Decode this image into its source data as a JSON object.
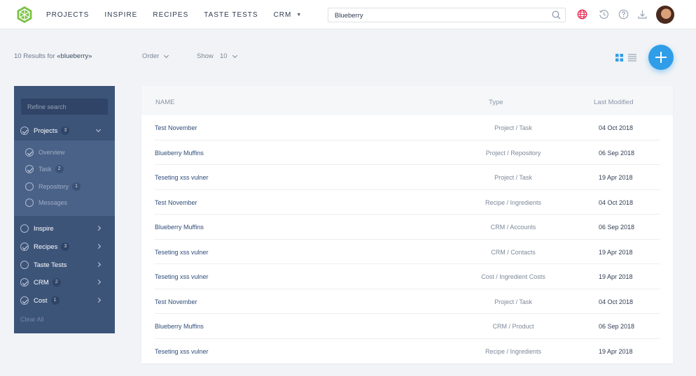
{
  "nav": {
    "items": [
      "PROJECTS",
      "INSPIRE",
      "RECIPES",
      "TASTE TESTS",
      "CRM"
    ]
  },
  "search": {
    "value": "Blueberry"
  },
  "results": {
    "prefix": "10 Results for",
    "query": "«blueberry»",
    "order_label": "Order",
    "show_label": "Show",
    "show_value": "10"
  },
  "sidebar": {
    "refine_placeholder": "Refine search",
    "projects": {
      "label": "Projects",
      "count": "3"
    },
    "sub_items": [
      {
        "label": "Overview",
        "count": ""
      },
      {
        "label": "Task",
        "count": "2"
      },
      {
        "label": "Repository",
        "count": "1"
      },
      {
        "label": "Messages",
        "count": ""
      }
    ],
    "categories": [
      {
        "label": "Inspire",
        "count": ""
      },
      {
        "label": "Recipes",
        "count": "3"
      },
      {
        "label": "Taste Tests",
        "count": ""
      },
      {
        "label": "CRM",
        "count": "2"
      },
      {
        "label": "Cost",
        "count": "1"
      }
    ],
    "clear_all": "Clear All"
  },
  "table": {
    "headers": {
      "name": "NAME",
      "type": "Type",
      "modified": "Last Modified"
    },
    "rows": [
      {
        "name": "Test November",
        "type": "Project / Task",
        "date": "04 Oct 2018"
      },
      {
        "name": "Blueberry Muffins",
        "type": "Project / Repository",
        "date": "06 Sep 2018"
      },
      {
        "name": "Teseting xss vulner",
        "type": "Project / Task",
        "date": "19 Apr 2018"
      },
      {
        "name": "Test November",
        "type": "Recipe / Ingredients",
        "date": "04 Oct 2018"
      },
      {
        "name": "Blueberry Muffins",
        "type": "CRM / Accounts",
        "date": "06 Sep 2018"
      },
      {
        "name": "Teseting xss vulner",
        "type": "CRM / Contacts",
        "date": "19 Apr 2018"
      },
      {
        "name": "Teseting xss vulner",
        "type": "Cost / Ingredient Costs",
        "date": "19 Apr 2018"
      },
      {
        "name": "Test November",
        "type": "Project / Task",
        "date": "04 Oct 2018"
      },
      {
        "name": "Blueberry Muffins",
        "type": "CRM / Product",
        "date": "06 Sep 2018"
      },
      {
        "name": "Teseting xss vulner",
        "type": "Recipe / Ingredients",
        "date": "19 Apr 2018"
      }
    ]
  },
  "colors": {
    "accent": "#2f9de8",
    "sidebar_bg": "#3d5479",
    "logo_green": "#7ac143",
    "globe_red": "#e8264d"
  },
  "icons": [
    "logo-icon",
    "search-icon",
    "globe-icon",
    "history-icon",
    "help-icon",
    "download-icon",
    "grid-view-icon",
    "list-view-icon",
    "plus-icon"
  ]
}
